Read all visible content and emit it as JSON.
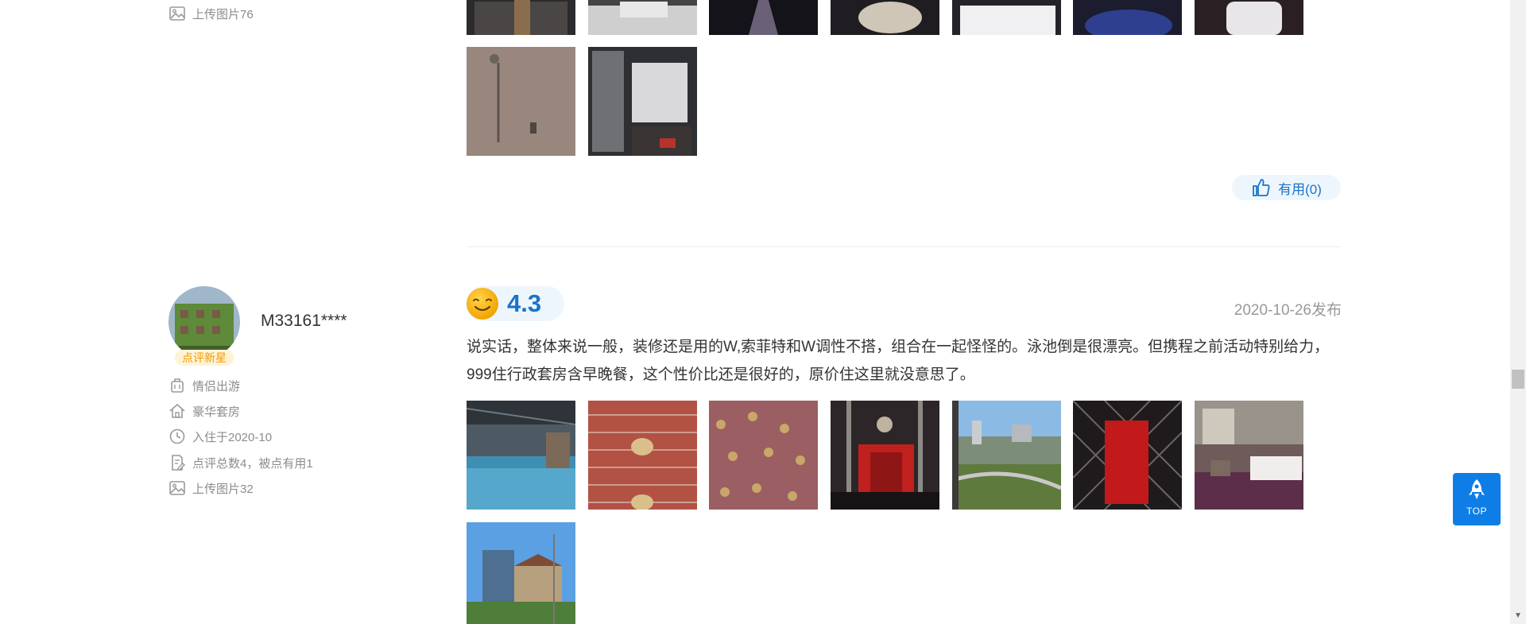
{
  "prev_review": {
    "upload_label": "上传图片76",
    "useful_label": "有用(0)"
  },
  "review": {
    "username": "M33161****",
    "badge": "点评新星",
    "meta": {
      "travel_type": "情侣出游",
      "room_type": "豪华套房",
      "checkin": "入住于2020-10",
      "review_count": "点评总数4，被点有用1",
      "upload_count": "上传图片32"
    },
    "score": "4.3",
    "date": "2020-10-26发布",
    "text": "说实话，整体来说一般，装修还是用的W,索菲特和W调性不搭，组合在一起怪怪的。泳池倒是很漂亮。但携程之前活动特别给力，999住行政套房含早晚餐，这个性价比还是很好的，原价住这里就没意思了。"
  },
  "top_button": {
    "label": "TOP"
  },
  "colors": {
    "accent": "#1a74c9",
    "badge": "#f29a00",
    "top_bg": "#0e7ee6"
  }
}
